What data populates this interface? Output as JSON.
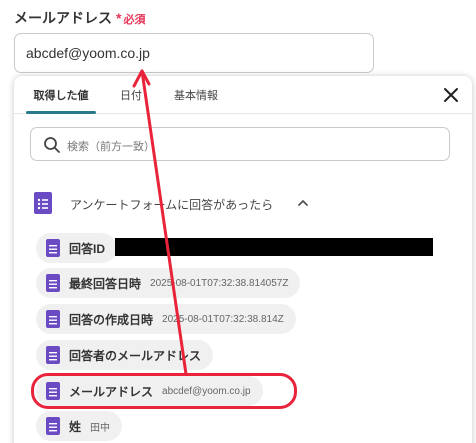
{
  "field": {
    "label": "メールアドレス",
    "required_mark": "*",
    "required_text": "必須",
    "value": "abcdef@yoom.co.jp"
  },
  "panel": {
    "tabs": [
      "取得した値",
      "日付",
      "基本情報"
    ],
    "active_tab": "取得した値",
    "search_placeholder": "検索（前方一致）",
    "group_title": "アンケートフォームに回答があったら",
    "items": [
      {
        "name": "回答ID",
        "value": ""
      },
      {
        "name": "最終回答日時",
        "value": "2025-08-01T07:32:38.814057Z"
      },
      {
        "name": "回答の作成日時",
        "value": "2025-08-01T07:32:38.814Z"
      },
      {
        "name": "回答者のメールアドレス",
        "value": ""
      },
      {
        "name": "メールアドレス",
        "value": "abcdef@yoom.co.jp"
      },
      {
        "name": "姓",
        "value": "田中"
      }
    ]
  },
  "colors": {
    "accent": "#2b7a8c",
    "required": "#e5365a",
    "annotation": "#e8233a",
    "form_icon": "#6a4bc4"
  },
  "icons": [
    "close-icon",
    "search-icon",
    "google-form-icon",
    "chevron-up-icon"
  ]
}
